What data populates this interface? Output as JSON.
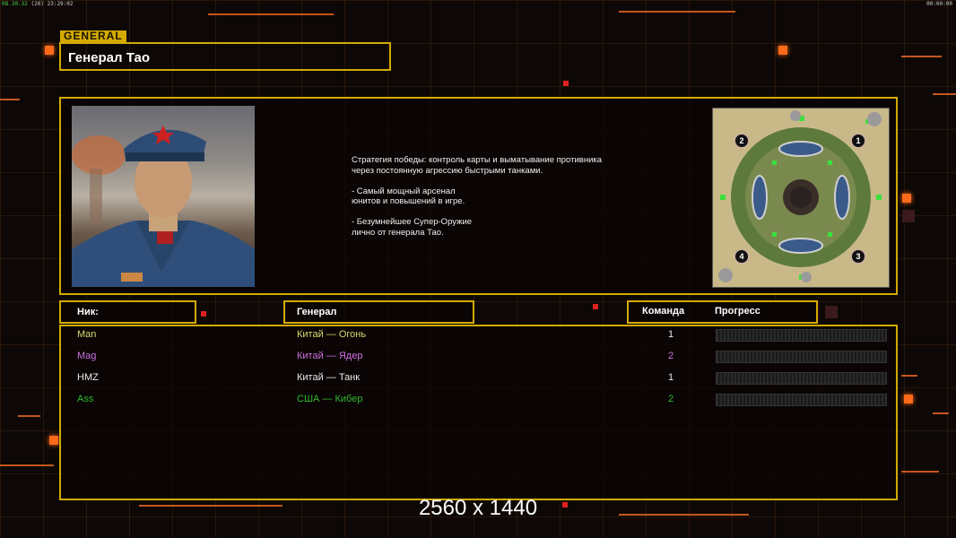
{
  "statusbar": {
    "left_green": "08.30.32",
    "left_mid": "(20)",
    "left_time": "23:29:02",
    "right_time": "00:00:00"
  },
  "general_tag": "GENERAL",
  "title": "Генерал Тао",
  "description": "Стратегия победы: контроль карты и выматывание противника\n через постоянную агрессию быстрыми танками.\n\n- Самый мощный арсенал\nюнитов и повышений в игре.\n\n- Безумнейшее Супер-Оружие\nлично от генерала Тао.",
  "minimap": {
    "spawns": [
      "2",
      "1",
      "4",
      "3"
    ]
  },
  "headers": {
    "nick": "Ник:",
    "general": "Генерал",
    "team": "Команда",
    "progress": "Прогресс"
  },
  "players": [
    {
      "nick": "Man",
      "general": "Китай — Огонь",
      "team": "1",
      "color": "#d8d870",
      "progress": 0
    },
    {
      "nick": "Mag",
      "general": "Китай — Ядер",
      "team": "2",
      "color": "#d070e0",
      "progress": 0
    },
    {
      "nick": "HMZ",
      "general": "Китай — Танк",
      "team": "1",
      "color": "#e8e8e8",
      "progress": 0
    },
    {
      "nick": "Ass",
      "general": "США — Кибер",
      "team": "2",
      "color": "#30b830",
      "progress": 0
    }
  ],
  "resolution": "2560 x 1440",
  "colors": {
    "accent": "#d4aa00",
    "orange": "#ff6a1a",
    "background": "#0d0806"
  }
}
